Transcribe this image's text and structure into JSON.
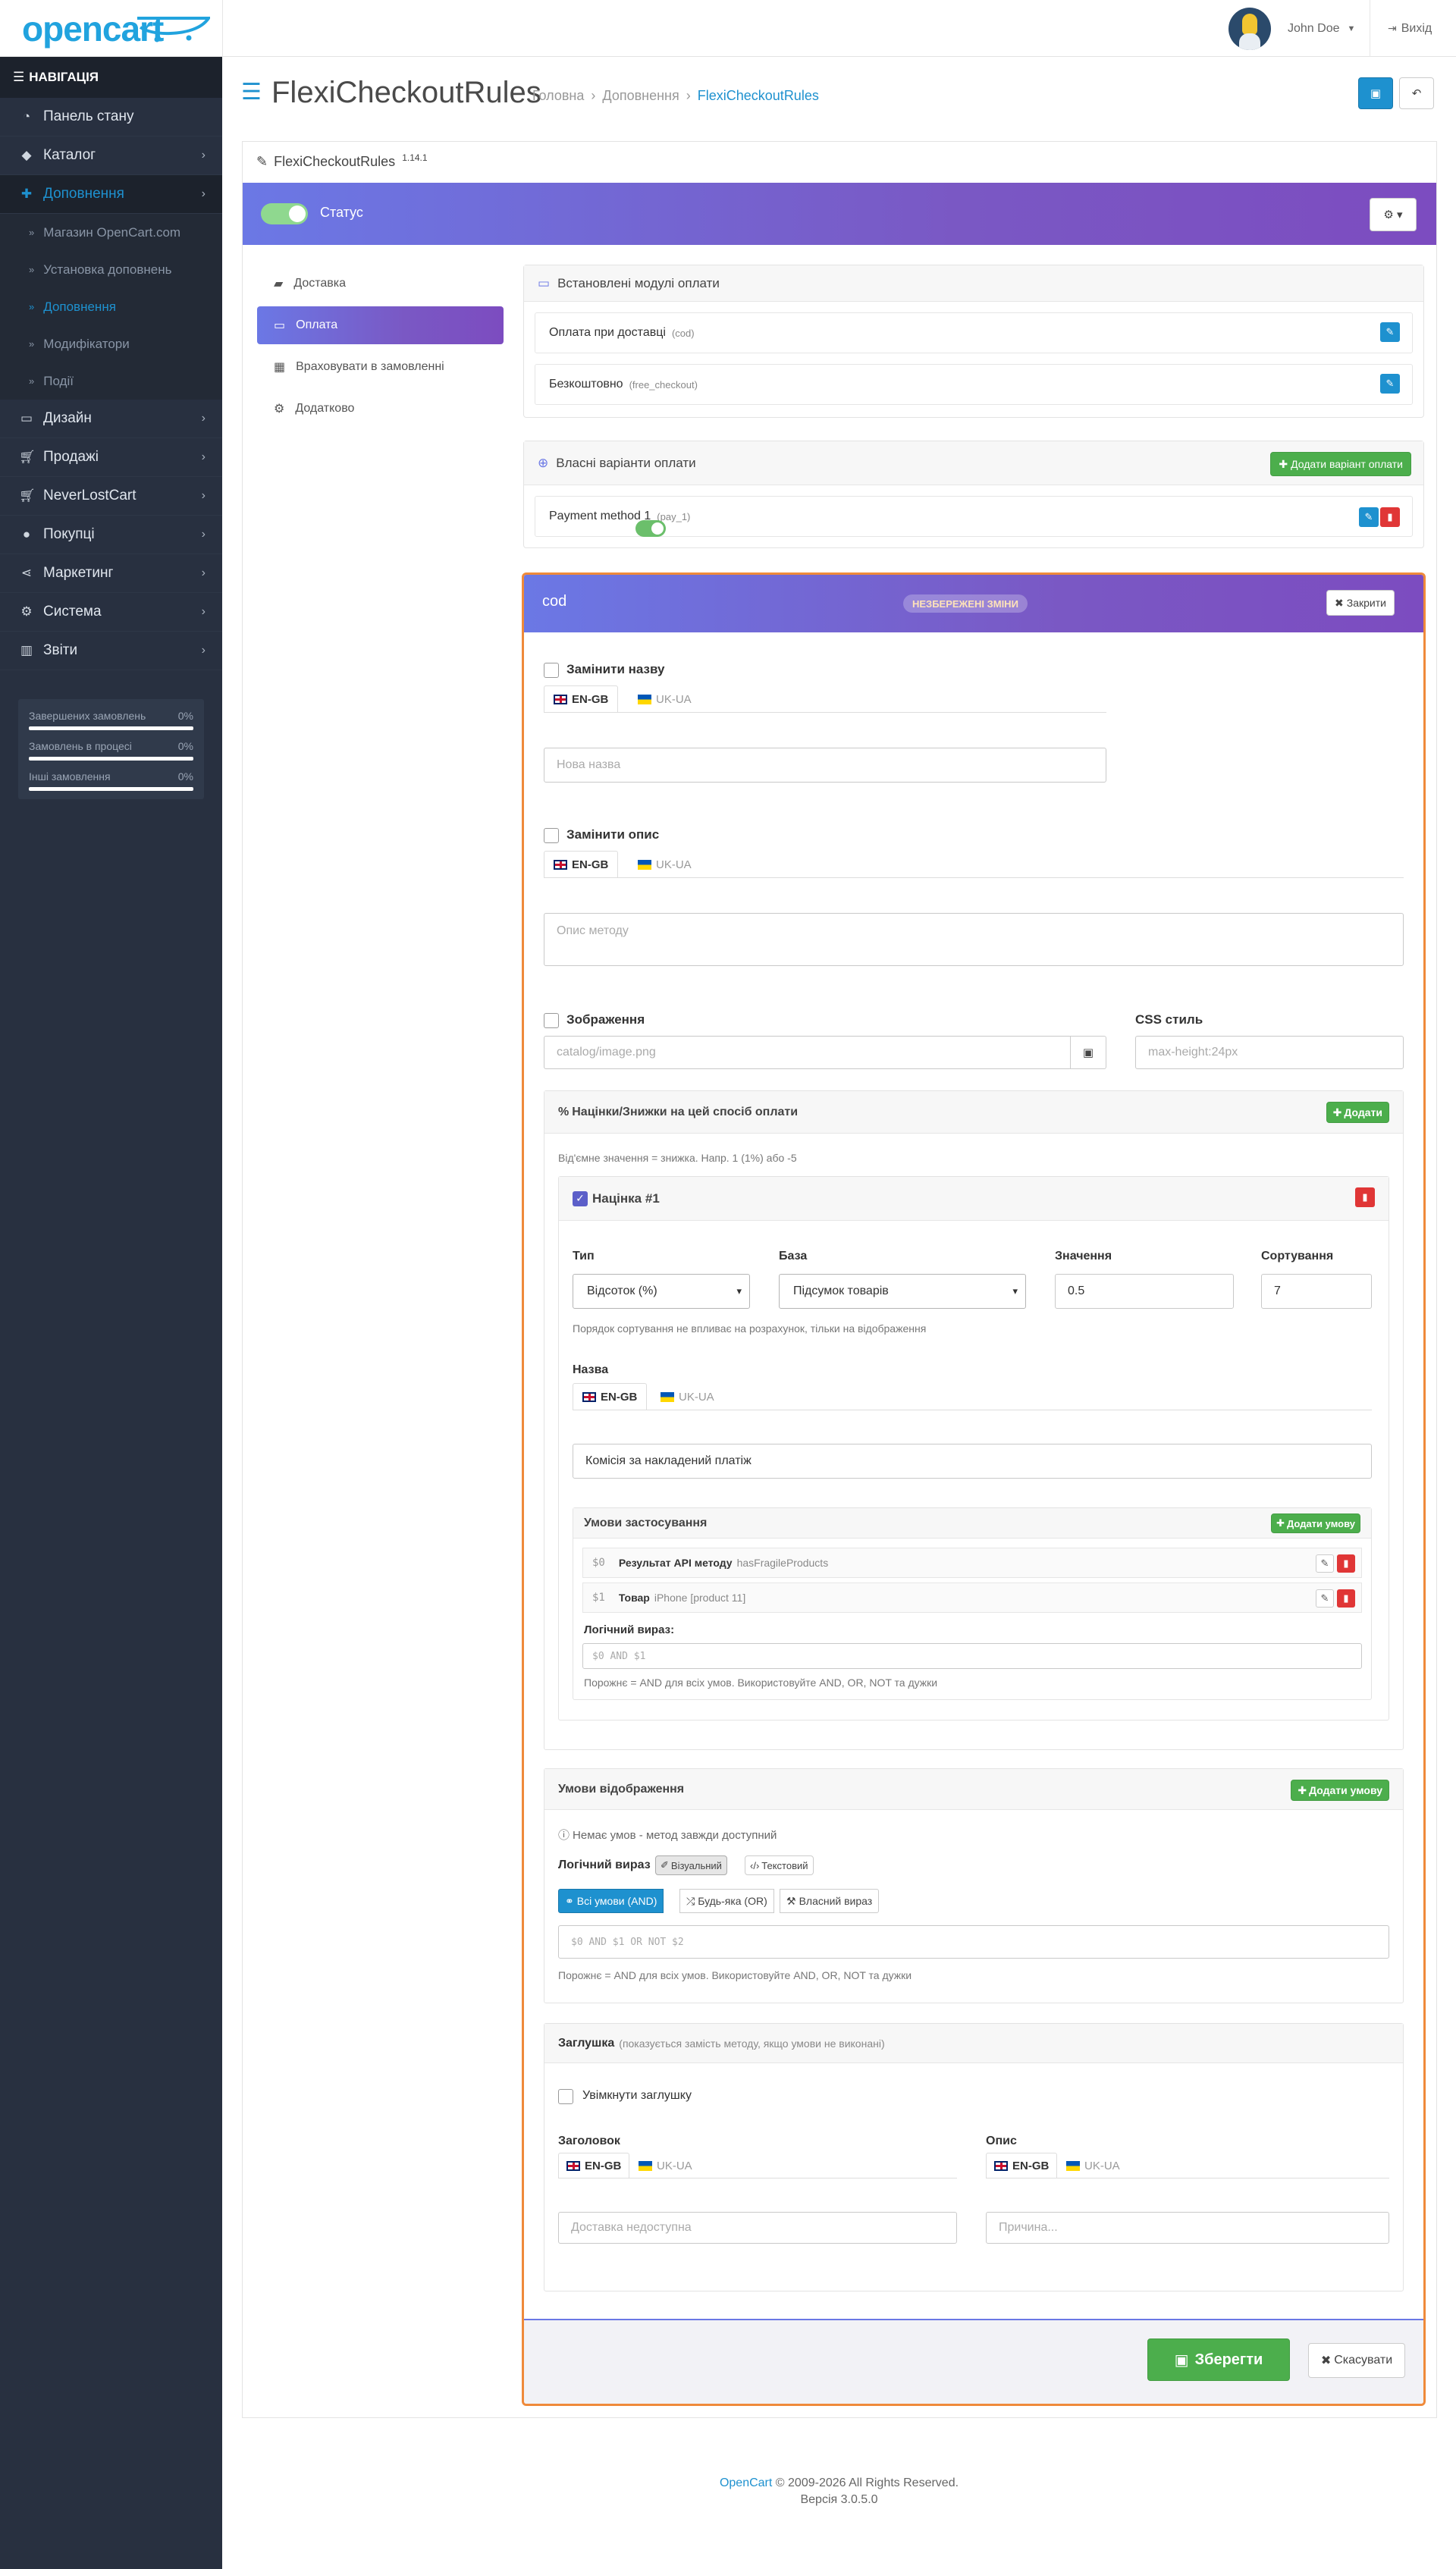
{
  "header": {
    "logo": "opencart",
    "user_name": "John Doe",
    "logout": "Вихід"
  },
  "sidebar": {
    "nav_title": "НАВІГАЦІЯ",
    "items": [
      {
        "label": "Панель стану",
        "icon": "dashboard-icon"
      },
      {
        "label": "Каталог",
        "icon": "tags-icon"
      },
      {
        "label": "Доповнення",
        "icon": "puzzle-icon"
      },
      {
        "label": "Дизайн",
        "icon": "desktop-icon"
      },
      {
        "label": "Продажі",
        "icon": "cart-icon"
      },
      {
        "label": "NeverLostCart",
        "icon": "cart-icon"
      },
      {
        "label": "Покупці",
        "icon": "user-icon"
      },
      {
        "label": "Маркетинг",
        "icon": "share-icon"
      },
      {
        "label": "Система",
        "icon": "cog-icon"
      },
      {
        "label": "Звіти",
        "icon": "chart-icon"
      }
    ],
    "sub_items": [
      "Магазин OpenCart.com",
      "Установка доповнень",
      "Доповнення",
      "Модифікатори",
      "Події"
    ],
    "stats": [
      {
        "label": "Завершених замовлень",
        "value": "0%"
      },
      {
        "label": "Замовлень в процесі",
        "value": "0%"
      },
      {
        "label": "Інші замовлення",
        "value": "0%"
      }
    ]
  },
  "page": {
    "title": "FlexiCheckoutRules",
    "breadcrumb": [
      "Головна",
      "Доповнення",
      "FlexiCheckoutRules"
    ],
    "panel_title": "FlexiCheckoutRules",
    "version": "1.14.1",
    "status_label": "Статус"
  },
  "left_tabs": [
    "Доставка",
    "Оплата",
    "Враховувати в замовленні",
    "Додатково"
  ],
  "installed": {
    "title": "Встановлені модулі оплати",
    "items": [
      {
        "name": "Оплата при доставці",
        "code": "(cod)"
      },
      {
        "name": "Безкоштовно",
        "code": "(free_checkout)"
      }
    ]
  },
  "custom": {
    "title": "Власні варіанти оплати",
    "add_button": "Додати варіант оплати",
    "items": [
      {
        "name": "Payment method 1",
        "code": "(pay_1)"
      }
    ]
  },
  "editor": {
    "title": "cod",
    "unsaved_badge": "НЕЗБЕРЕЖЕНІ ЗМІНИ",
    "close_button": "Закрити",
    "replace_name": "Замінити назву",
    "lang_en": "EN-GB",
    "lang_ua": "UK-UA",
    "name_placeholder": "Нова назва",
    "replace_desc": "Замінити опис",
    "desc_placeholder": "Опис методу",
    "image_label": "Зображення",
    "image_placeholder": "catalog/image.png",
    "css_label": "CSS стиль",
    "css_placeholder": "max-height:24px",
    "fees": {
      "title": "Націнки/Знижки на цей спосіб оплати",
      "add": "Додати",
      "hint": "Від'ємне значення = знижка. Напр. 1 (1%) або -5",
      "item_title": "Націнка #1",
      "type_label": "Тип",
      "type_value": "Відсоток (%)",
      "base_label": "База",
      "base_value": "Підсумок товарів",
      "value_label": "Значення",
      "value": "0.5",
      "sort_label": "Сортування",
      "sort_value": "7",
      "sort_hint": "Порядок сортування не впливає на розрахунок, тільки на відображення",
      "name_label": "Назва",
      "name_value": "Комісія за накладений платіж",
      "conditions_title": "Умови застосування",
      "add_condition": "Додати умову",
      "conditions": [
        {
          "var": "$0",
          "label": "Результат API методу",
          "detail": "hasFragileProducts"
        },
        {
          "var": "$1",
          "label": "Товар",
          "detail": "iPhone [product 11]"
        }
      ],
      "logic_label": "Логічний вираз:",
      "logic_placeholder": "$0 AND $1",
      "logic_hint": "Порожнє = AND для всіх умов. Використовуйте AND, OR, NOT та дужки"
    },
    "display": {
      "title": "Умови відображення",
      "add_condition": "Додати умову",
      "info": "Немає умов - метод завжди доступний",
      "logic_label": "Логічний вираз",
      "mode_visual": "Візуальний",
      "mode_text": "Текстовий",
      "btn_and": "Всі умови (AND)",
      "btn_or": "Будь-яка (OR)",
      "btn_custom": "Власний вираз",
      "expr_placeholder": "$0 AND $1 OR NOT $2",
      "hint": "Порожнє = AND для всіх умов. Використовуйте AND, OR, NOT та дужки"
    },
    "stub": {
      "title": "Заглушка",
      "subtitle": "(показується замість методу, якщо умови не виконані)",
      "enable": "Увімкнути заглушку",
      "heading_label": "Заголовок",
      "desc_label": "Опис",
      "heading_placeholder": "Доставка недоступна",
      "desc_placeholder": "Причина..."
    },
    "save": "Зберегти",
    "cancel": "Скасувати"
  },
  "footer": {
    "link": "OpenCart",
    "copyright": "© 2009-2026 All Rights Reserved.",
    "version": "Версія 3.0.5.0"
  }
}
